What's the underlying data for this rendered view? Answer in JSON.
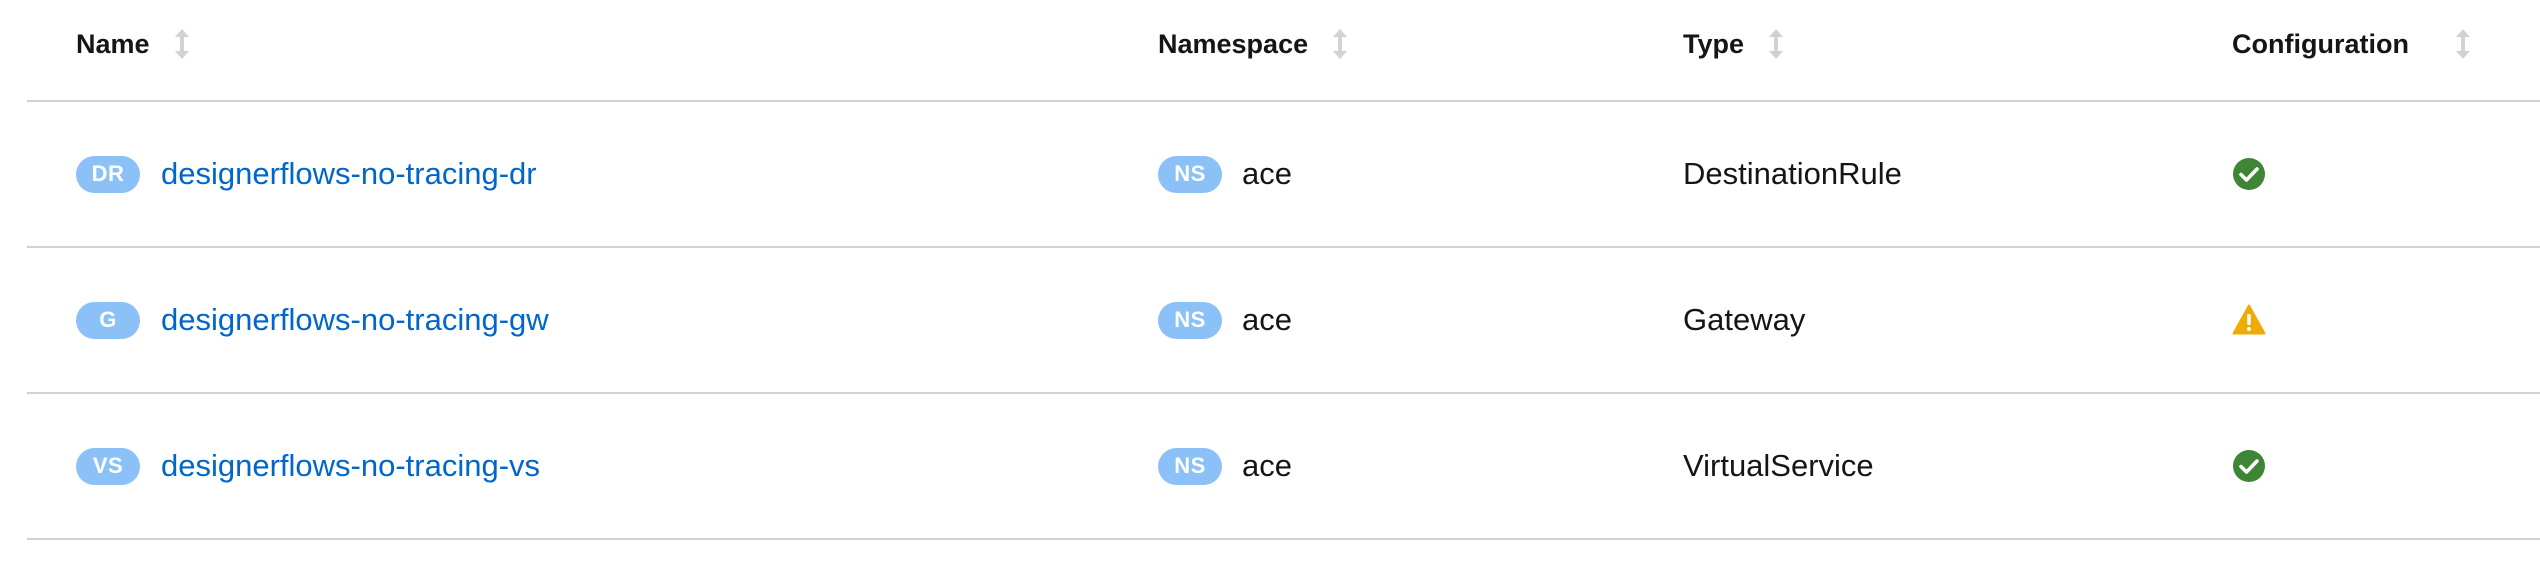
{
  "table": {
    "columns": [
      {
        "key": "name",
        "label": "Name"
      },
      {
        "key": "namespace",
        "label": "Namespace"
      },
      {
        "key": "type",
        "label": "Type"
      },
      {
        "key": "configuration",
        "label": "Configuration"
      }
    ],
    "rows": [
      {
        "badge": "DR",
        "name": "designerflows-no-tracing-dr",
        "ns_badge": "NS",
        "namespace": "ace",
        "type": "DestinationRule",
        "config_status": "valid",
        "config_icon": "check-circle-icon"
      },
      {
        "badge": "G",
        "name": "designerflows-no-tracing-gw",
        "ns_badge": "NS",
        "namespace": "ace",
        "type": "Gateway",
        "config_status": "warning",
        "config_icon": "warning-triangle-icon"
      },
      {
        "badge": "VS",
        "name": "designerflows-no-tracing-vs",
        "ns_badge": "NS",
        "namespace": "ace",
        "type": "VirtualService",
        "config_status": "valid",
        "config_icon": "check-circle-icon"
      }
    ]
  },
  "colors": {
    "badge_bg": "#8bc1f7",
    "link": "#0066cc",
    "success": "#3e8635",
    "warning": "#f0ab00",
    "sort_icon": "#d2d2d2",
    "divider": "#d2d2d2"
  }
}
